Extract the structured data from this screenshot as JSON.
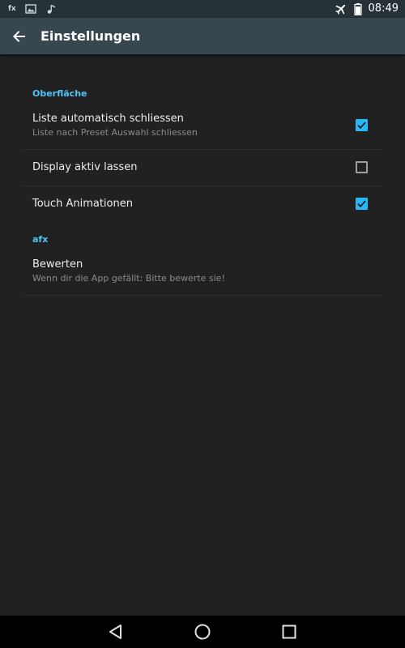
{
  "status_bar": {
    "left_icons": [
      "fx-icon",
      "image-icon",
      "music-note-icon"
    ],
    "fx_label": "fx",
    "airplane_icon": "airplane-icon",
    "battery_icon": "battery-icon",
    "time": "08:49"
  },
  "toolbar": {
    "back_icon": "arrow-back-icon",
    "title": "Einstellungen"
  },
  "sections": [
    {
      "category": "Oberfläche",
      "items": [
        {
          "title": "Liste automatisch schliessen",
          "summary": "Liste nach Preset Auswahl schliessen",
          "checked": true
        },
        {
          "title": "Display aktiv lassen",
          "checked": false
        },
        {
          "title": "Touch Animationen",
          "checked": true
        }
      ]
    },
    {
      "category": "afx",
      "items": [
        {
          "title": "Bewerten",
          "summary": "Wenn dir die App gefällt: Bitte bewerte sie!"
        }
      ]
    }
  ],
  "nav_bar": {
    "back": "triangle-back-icon",
    "home": "circle-home-icon",
    "recents": "square-recents-icon"
  },
  "colors": {
    "accent": "#29b6f6",
    "category": "#4fc3f7",
    "toolbar": "#37474f",
    "status_bar": "#263238",
    "background": "#212121"
  }
}
